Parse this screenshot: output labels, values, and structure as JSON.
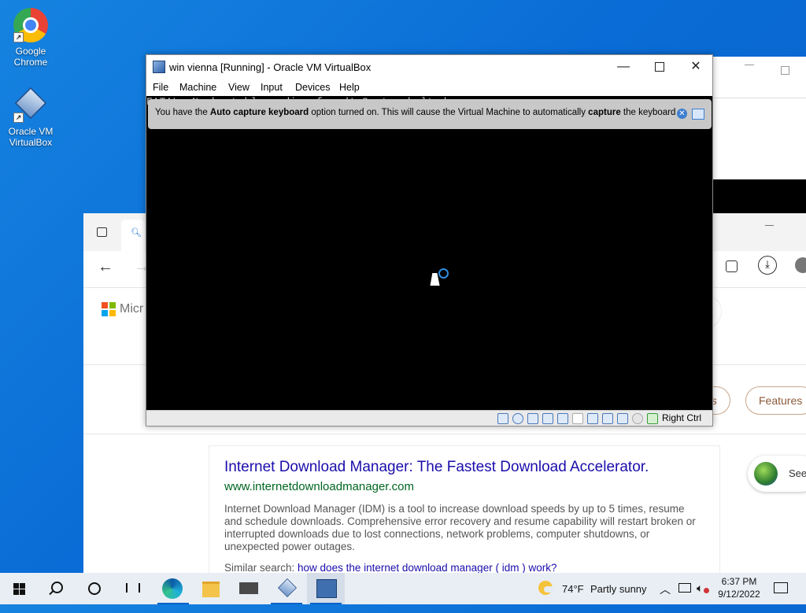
{
  "desktop": {
    "icons": [
      {
        "label": "Google Chrome",
        "icon": "chrome-icon"
      },
      {
        "label": "Oracle VM VirtualBox",
        "icon": "virtualbox-icon"
      }
    ]
  },
  "vbox": {
    "title": "win vienna [Running] - Oracle VM VirtualBox",
    "menu": [
      "File",
      "Machine",
      "View",
      "Input",
      "Devices",
      "Help"
    ],
    "console_text": "FATAL: No bootable medium found! System halted.",
    "notice_pre": "You have the ",
    "notice_bold1": "Auto capture keyboard",
    "notice_mid": " option turned on. This will cause the Virtual Machine to automatically ",
    "notice_bold2": "capture",
    "notice_post": " the keyboard",
    "host_key": "Right Ctrl"
  },
  "edge": {
    "logo_text": "Micr",
    "chips": [
      "gs",
      "Features"
    ],
    "side_card_text": "See",
    "result": {
      "title": "Internet Download Manager: The Fastest Download Accelerator.",
      "url": "www.internetdownloadmanager.com",
      "description": "Internet Download Manager (IDM) is a tool to increase download speeds by up to 5 times, resume and schedule downloads. Comprehensive error recovery and resume capability will restart broken or interrupted downloads due to lost connections, network problems, computer shutdowns, or unexpected power outages.",
      "similar_label": "Similar search: ",
      "similar_link": "how does the internet download manager ( idm ) work?"
    }
  },
  "taskbar": {
    "weather_temp": "74°F",
    "weather_text": "Partly sunny",
    "time": "6:37 PM",
    "date": "9/12/2022"
  }
}
